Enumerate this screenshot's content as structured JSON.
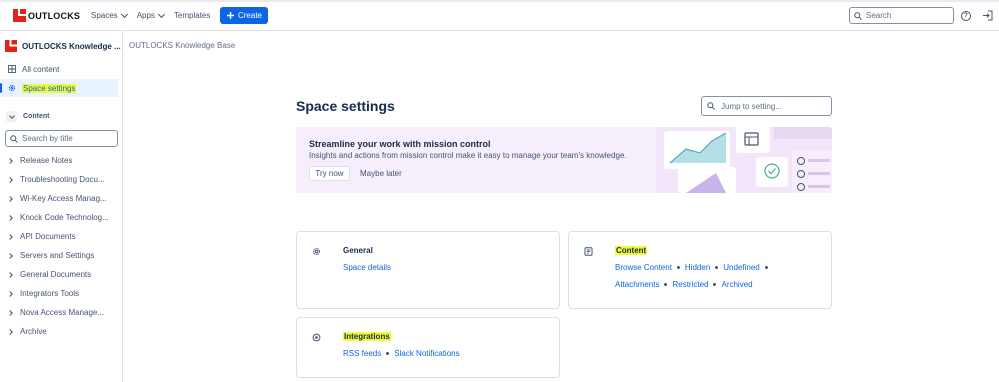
{
  "topbar": {
    "logo_text": "OUTLOCKS",
    "nav": [
      {
        "label": "Spaces"
      },
      {
        "label": "Apps"
      },
      {
        "label": "Templates"
      }
    ],
    "create_label": "Create",
    "search_placeholder": "Search"
  },
  "sidebar": {
    "space_title": "OUTLOCKS Knowledge ...",
    "items": [
      {
        "label": "All content",
        "icon": "grid-icon"
      },
      {
        "label": "Space settings",
        "icon": "gear-icon",
        "active": true
      }
    ],
    "content_header": "Content",
    "tree_search_placeholder": "Search by title",
    "tree": [
      {
        "label": "Release Notes"
      },
      {
        "label": "Troubleshooting Docu..."
      },
      {
        "label": "Wi-Key Access Manag..."
      },
      {
        "label": "Knock Code Technolog..."
      },
      {
        "label": "API Documents"
      },
      {
        "label": "Servers and Settings"
      },
      {
        "label": "General Documents"
      },
      {
        "label": "Integrators Tools"
      },
      {
        "label": "Nova Access Manage..."
      },
      {
        "label": "Archive"
      }
    ]
  },
  "main": {
    "breadcrumb": "OUTLOCKS Knowledge Base",
    "title": "Space settings",
    "jump_placeholder": "Jump to setting...",
    "banner": {
      "title": "Streamline your work with mission control",
      "description": "Insights and actions from mission control make it easy to manage your team's knowledge.",
      "try_label": "Try now",
      "later_label": "Maybe later"
    },
    "cards": {
      "general": {
        "title": "General",
        "links": [
          "Space details"
        ]
      },
      "content": {
        "title": "Content",
        "links_row1": [
          "Browse Content",
          "Hidden",
          "Undefined"
        ],
        "links_row2": [
          "Attachments",
          "Restricted",
          "Archived"
        ]
      },
      "integrations": {
        "title": "Integrations",
        "links": [
          "RSS feeds",
          "Slack Notifications"
        ]
      }
    }
  },
  "colors": {
    "accent": "#0c66e4",
    "highlight": "#f0fb36",
    "brand_red": "#e2231a",
    "banner_bg": "#f7eefc"
  }
}
